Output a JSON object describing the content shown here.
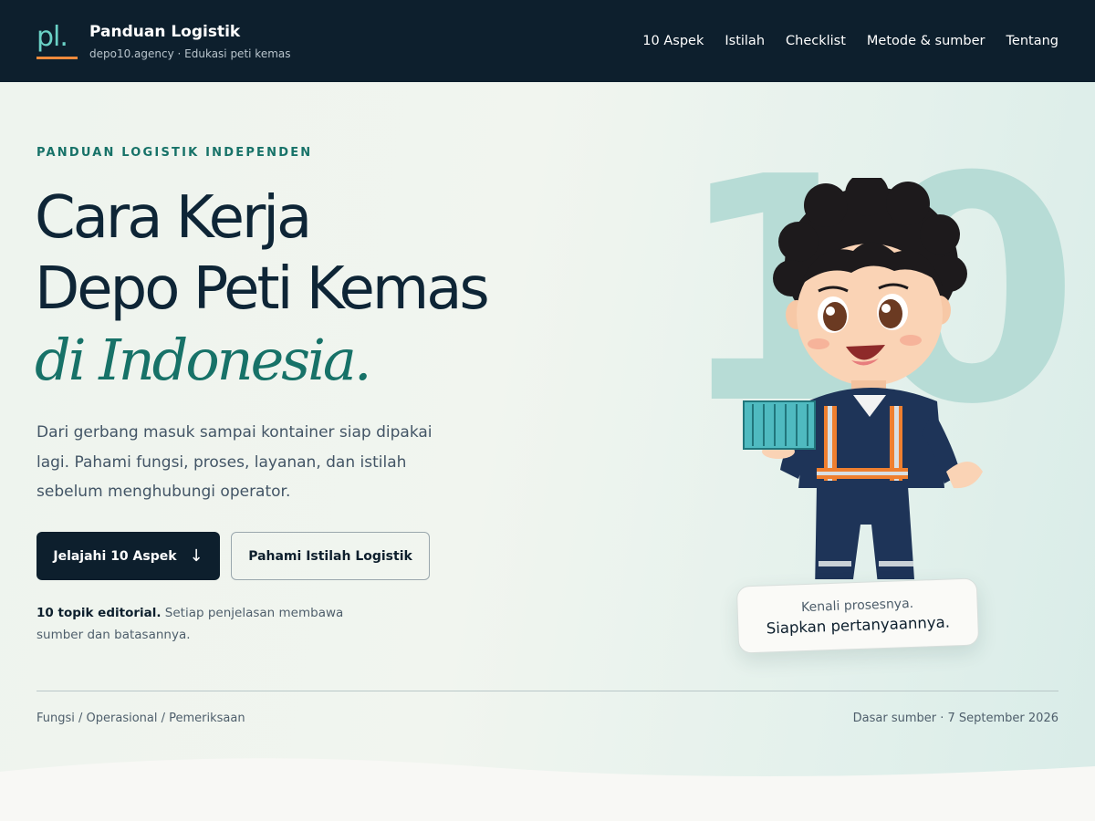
{
  "header": {
    "logo_text": "pl.",
    "title": "Panduan Logistik",
    "subtitle": "depo10.agency · Edukasi peti kemas",
    "nav": [
      "10 Aspek",
      "Istilah",
      "Checklist",
      "Metode & sumber",
      "Tentang"
    ]
  },
  "hero": {
    "eyebrow": "PANDUAN LOGISTIK INDEPENDEN",
    "headline_line1": "Cara Kerja",
    "headline_line2": "Depo Peti Kemas",
    "headline_accent": "di Indonesia.",
    "lede": "Dari gerbang masuk sampai kontainer siap dipakai lagi. Pahami fungsi, proses, layanan, dan istilah sebelum menghubungi operator.",
    "primary_button": "Jelajahi 10 Aspek",
    "primary_button_icon": "↓",
    "secondary_button": "Pahami Istilah Logistik",
    "note_bold": "10 topik editorial.",
    "note_rest": " Setiap penjelasan membawa sumber dan batasannya.",
    "big_number": "10",
    "speech_line1": "Kenali prosesnya.",
    "speech_line2": "Siapkan pertanyaannya."
  },
  "footer": {
    "breadcrumb": "Fungsi / Operasional / Pemeriksaan",
    "source_date": "Dasar sumber · 7 September 2026"
  },
  "colors": {
    "header_bg": "#0d1f2d",
    "accent_teal": "#177268",
    "logo_teal": "#6ad1c6",
    "logo_orange": "#ef8a3c",
    "big_number": "#b7dcd6"
  },
  "icons": {
    "primary_button_icon": "arrow-down-icon",
    "mascot": "mascot-worker-with-container-illustration"
  }
}
